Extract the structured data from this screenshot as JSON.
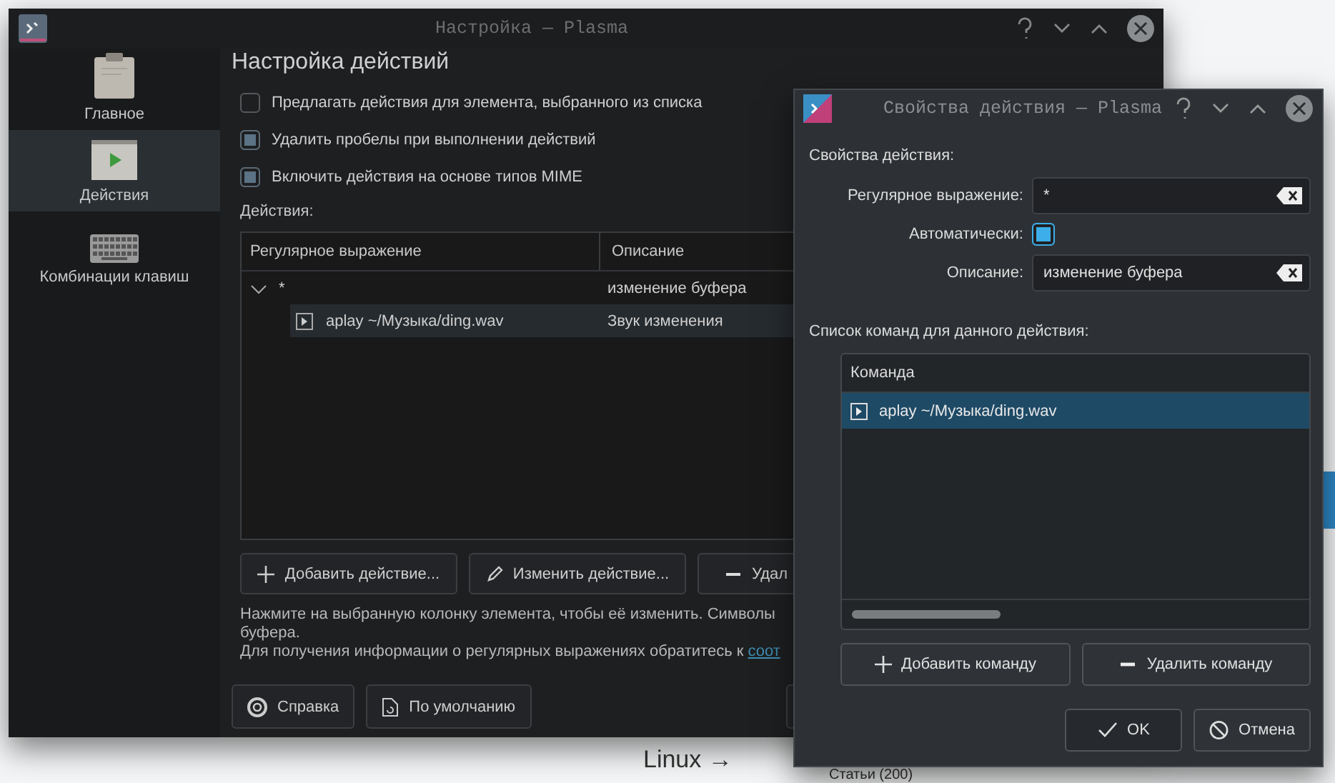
{
  "background_page": {
    "texts": [
      "Linux →",
      "Статьи (200)"
    ]
  },
  "settings_window": {
    "title": "Настройка — Plasma",
    "sidebar": {
      "items": [
        {
          "label": "Главное",
          "selected": false
        },
        {
          "label": "Действия",
          "selected": true
        },
        {
          "label": "Комбинации клавиш",
          "selected": false
        }
      ]
    },
    "heading": "Настройка действий",
    "options": [
      {
        "label": "Предлагать действия для элемента, выбранного из списка",
        "checked": false
      },
      {
        "label": "Удалить пробелы при выполнении действий",
        "checked": true
      },
      {
        "label": "Включить действия на основе типов MIME",
        "checked": true
      }
    ],
    "actions_label": "Действия:",
    "table": {
      "columns": [
        "Регулярное выражение",
        "Описание"
      ],
      "rows": [
        {
          "regex": "*",
          "description": "изменение буфера",
          "expanded": true,
          "selected": false,
          "children": [
            {
              "command": "aplay ~/Музыка/ding.wav",
              "description": "Звук изменения",
              "selected": true
            }
          ]
        }
      ]
    },
    "action_buttons": [
      "Добавить действие...",
      "Изменить действие...",
      "Удал"
    ],
    "help_lines": [
      "Нажмите на выбранную колонку элемента, чтобы её изменить. Символы",
      "буфера."
    ],
    "help_info": {
      "text": "Для получения информации о регулярных выражениях обратитесь к",
      "link": "соот"
    },
    "footer_buttons": [
      "Справка",
      "По умолчанию"
    ]
  },
  "properties_dialog": {
    "title": "Свойства действия — Plasma",
    "section_label": "Свойства действия:",
    "fields": [
      {
        "kind": "text",
        "label": "Регулярное выражение:",
        "value": "*"
      },
      {
        "kind": "checkbox",
        "label": "Автоматически:",
        "checked": true
      },
      {
        "kind": "text",
        "label": "Описание:",
        "value": "изменение буфера"
      }
    ],
    "commands_label": "Список команд для данного действия:",
    "commands": {
      "column": "Команда",
      "rows": [
        {
          "command": "aplay ~/Музыка/ding.wav",
          "selected": true
        }
      ]
    },
    "command_buttons": [
      "Добавить команду",
      "Удалить команду"
    ],
    "buttons": [
      "OK",
      "Отмена"
    ]
  }
}
